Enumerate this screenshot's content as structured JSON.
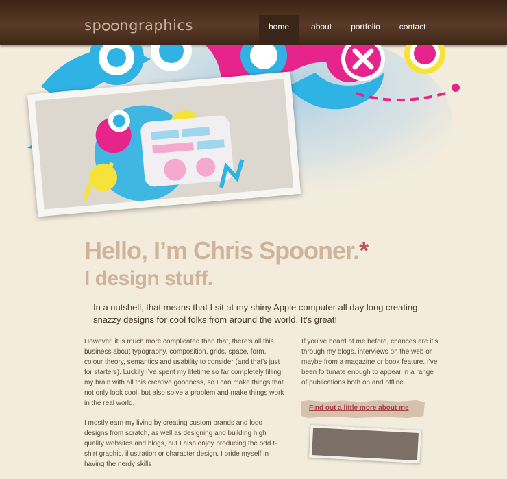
{
  "header": {
    "logo_text": "spoongraphics",
    "nav": [
      {
        "label": "home",
        "active": true
      },
      {
        "label": "about"
      },
      {
        "label": "portfolio"
      },
      {
        "label": "contact"
      }
    ]
  },
  "main": {
    "headline": "Hello, I’m Chris Spooner.",
    "headline_mark": "*",
    "subheadline": "I design stuff.",
    "intro": "In a nutshell, that means that I sit at my shiny Apple computer all day long creating snazzy designs for cool folks from around the world. It’s great!",
    "left_paragraphs": [
      "However, it is much more complicated than that, there’s all this business about typography, composition, grids, space, form, colour theory, semantics and usability to consider (and that’s just for starters). Luckily I’ve spent my lifetime so far completely filling my brain with all this creative goodness, so I can make things that not only look cool, but also solve a problem and make things work in the real world.",
      "I mostly earn my living by creating custom brands and logo designs from scratch, as well as designing and building high quality websites and blogs, but I also enjoy producing the odd t-shirt graphic, illustration or character design. I pride myself in having the nerdy skills"
    ],
    "right_paragraph": "If you’ve heard of me before, chances are it’s through my blogs, interviews on the web or maybe from a magazine or book feature. I’ve been fortunate enough to appear in a range of publications both on and offline.",
    "more_button": "Find out a little more about me"
  },
  "colors": {
    "header_brown": "#4a2f1f",
    "page_bg": "#f3ecdd",
    "headline": "#cfb39a",
    "accent_red": "#b55a5a",
    "button_text": "#a8434b",
    "cyan": "#2fb3e4",
    "magenta": "#e6248b",
    "yellow": "#f6e33a"
  }
}
